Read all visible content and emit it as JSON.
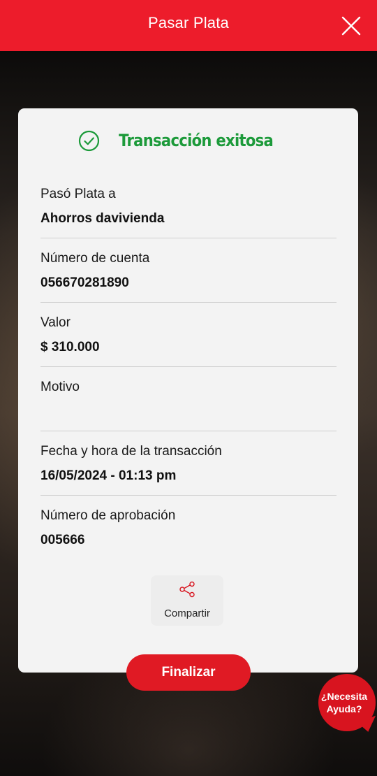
{
  "header": {
    "title": "Pasar Plata",
    "close_icon": "close-icon"
  },
  "status": {
    "text": "Transacción exitosa",
    "icon": "check-circle-icon",
    "color": "#1c9a3a"
  },
  "details": {
    "destination": {
      "label": "Pasó Plata a",
      "value": "Ahorros davivienda"
    },
    "account": {
      "label": "Número de cuenta",
      "value": "056670281890"
    },
    "amount": {
      "label": "Valor",
      "value": "$ 310.000"
    },
    "reason": {
      "label": "Motivo",
      "value": ""
    },
    "datetime": {
      "label": "Fecha y hora de la transacción",
      "value": "16/05/2024 - 01:13 pm"
    },
    "approval": {
      "label": "Número de aprobación",
      "value": "005666"
    }
  },
  "share": {
    "label": "Compartir",
    "icon": "share-icon"
  },
  "finish": {
    "label": "Finalizar"
  },
  "help": {
    "line1": "¿Necesita",
    "line2": "Ayuda?"
  },
  "colors": {
    "brand_red": "#ed1c2b",
    "button_red": "#e01a24",
    "success_green": "#1c9a3a"
  }
}
